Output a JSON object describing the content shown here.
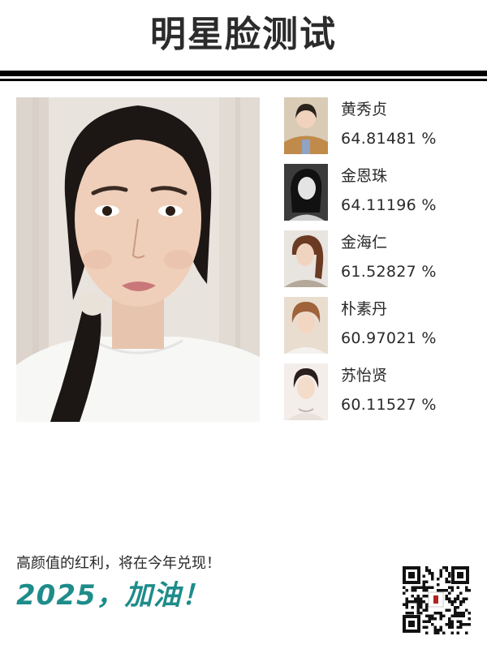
{
  "header": {
    "title": "明星脸测试"
  },
  "main_photo": {
    "alt": "user-photo"
  },
  "matches": [
    {
      "name": "黄秀贞",
      "score": "64.81481 %"
    },
    {
      "name": "金恩珠",
      "score": "64.11196 %"
    },
    {
      "name": "金海仁",
      "score": "61.52827 %"
    },
    {
      "name": "朴素丹",
      "score": "60.97021 %"
    },
    {
      "name": "苏怡贤",
      "score": "60.11527 %"
    }
  ],
  "footer": {
    "slogan": "高颜值的红利，将在今年兑现！",
    "cheer": "2025，加油！"
  },
  "colors": {
    "accent": "#1e8c8a",
    "rule": "#000000",
    "text": "#2a2a2a"
  }
}
